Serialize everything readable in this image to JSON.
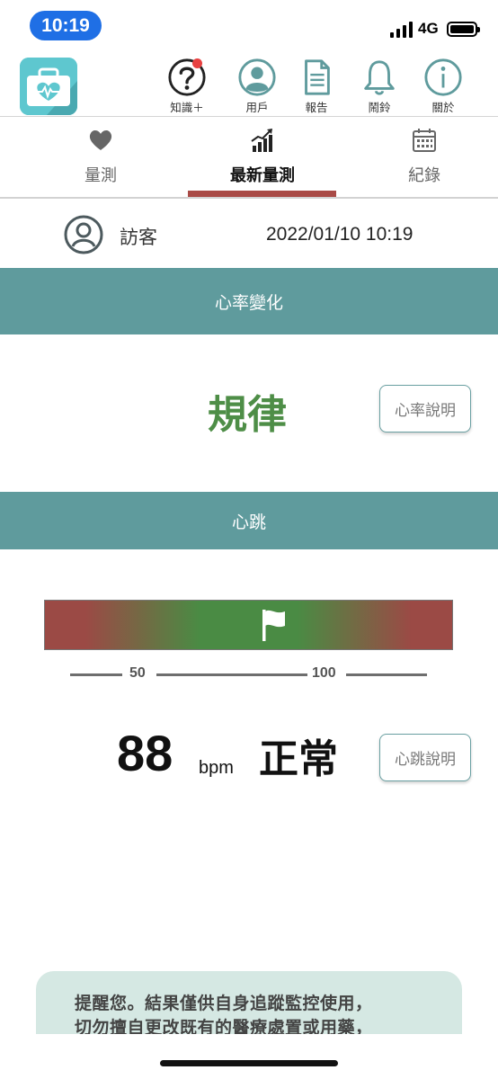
{
  "status_bar": {
    "time": "10:19",
    "network": "4G"
  },
  "header": {
    "tools": [
      {
        "label": "知識＋",
        "icon": "question-mark-icon",
        "badge": true
      },
      {
        "label": "用戶",
        "icon": "user-icon"
      },
      {
        "label": "報告",
        "icon": "document-icon"
      },
      {
        "label": "鬧鈴",
        "icon": "bell-icon"
      },
      {
        "label": "關於",
        "icon": "info-icon"
      }
    ]
  },
  "tabs": [
    {
      "label": "量測",
      "icon": "heart-icon",
      "active": false
    },
    {
      "label": "最新量測",
      "icon": "bar-chart-icon",
      "active": true
    },
    {
      "label": "紀錄",
      "icon": "calendar-icon",
      "active": false
    }
  ],
  "user": {
    "name": "訪客",
    "timestamp": "2022/01/10 10:19"
  },
  "rhythm": {
    "section_title": "心率變化",
    "value": "規律",
    "info_button": "心率說明"
  },
  "heart_rate": {
    "section_title": "心跳",
    "value": "88",
    "unit": "bpm",
    "status": "正常",
    "info_button": "心跳說明",
    "scale_ticks": [
      "50",
      "100"
    ]
  },
  "reminder": {
    "line1": "提醒您。結果僅供自身追蹤監控使用，",
    "line2": "切勿擅自更改既有的醫療處置或用藥，"
  },
  "colors": {
    "teal_band": "#5f9b9d",
    "accent_red": "#a94a46",
    "green_text": "#4e8e47",
    "reminder_bg": "#d5e8e3"
  }
}
